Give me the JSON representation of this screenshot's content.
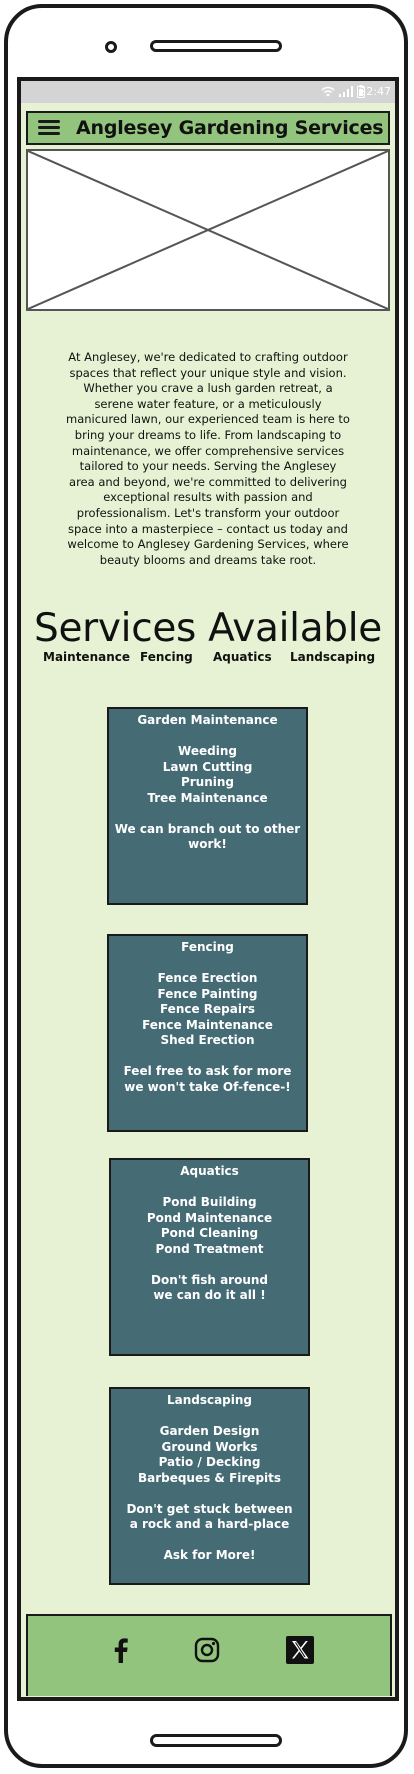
{
  "status_bar": {
    "time": "22:47"
  },
  "header": {
    "title": "Anglesey Gardening Services",
    "menu_icon": "hamburger-menu-icon"
  },
  "hero": {
    "image": "placeholder-image"
  },
  "intro": "At Anglesey, we're dedicated to crafting outdoor spaces that reflect your unique style and vision. Whether you crave a lush garden retreat, a serene water feature, or a meticulously manicured lawn, our experienced team is here to bring your dreams to life. From landscaping to maintenance, we offer comprehensive services tailored to your needs. Serving the Anglesey area and beyond, we're committed to delivering exceptional results with passion and professionalism. Let's transform your outdoor space into a masterpiece – contact us today and welcome to Anglesey Gardening Services, where beauty blooms and dreams take root.",
  "services": {
    "heading": "Services Available",
    "links": [
      "Maintenance",
      "Fencing",
      "Aquatics",
      "Landscaping"
    ],
    "cards": [
      {
        "title": "Garden Maintenance",
        "items": [
          "Weeding",
          "Lawn Cutting",
          "Pruning",
          "Tree Maintenance"
        ],
        "note": [
          "We can branch out to other",
          "work!"
        ]
      },
      {
        "title": "Fencing",
        "items": [
          "Fence Erection",
          "Fence Painting",
          "Fence Repairs",
          "Fence Maintenance",
          "Shed Erection"
        ],
        "note": [
          "Feel free to ask for more",
          "we won't take Of-fence-!"
        ]
      },
      {
        "title": "Aquatics",
        "items": [
          "Pond Building",
          "Pond Maintenance",
          "Pond Cleaning",
          "Pond Treatment"
        ],
        "note": [
          "Don't fish around",
          "we can do it all !"
        ]
      },
      {
        "title": "Landscaping",
        "items": [
          "Garden Design",
          "Ground Works",
          "Patio / Decking",
          "Barbeques & Firepits"
        ],
        "note": [
          "Don't get stuck between",
          "a rock and a hard-place"
        ],
        "extra": "Ask for More!"
      }
    ]
  },
  "footer": {
    "icons": [
      "facebook-icon",
      "instagram-icon",
      "x-twitter-icon"
    ]
  },
  "colors": {
    "header_green": "#93c47d",
    "page_bg": "#e6f2d3",
    "card_bg": "#456b75"
  }
}
